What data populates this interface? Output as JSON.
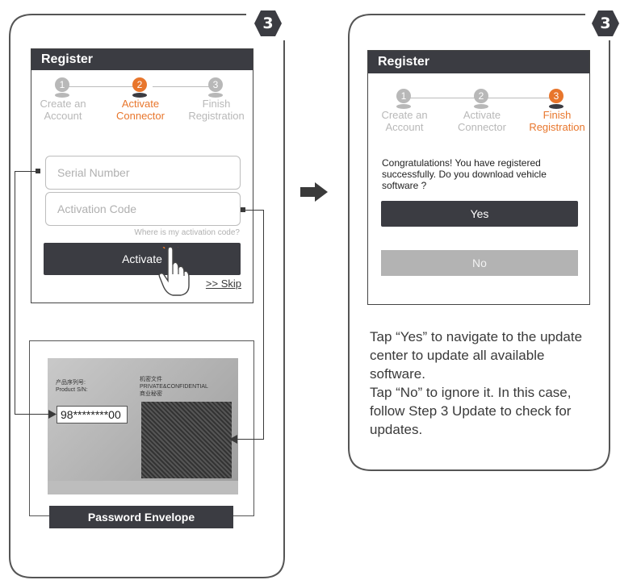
{
  "badges": {
    "left": "3",
    "right": "3"
  },
  "left_phone": {
    "title": "Register",
    "steps": [
      {
        "num": "1",
        "label": "Create an Account",
        "state": "done"
      },
      {
        "num": "2",
        "label": "Activate Connector",
        "state": "active"
      },
      {
        "num": "3",
        "label": "Finish Registration",
        "state": "todo"
      }
    ],
    "serial_placeholder": "Serial Number",
    "activation_placeholder": "Activation Code",
    "help_link": "Where is my activation code?",
    "activate_label": "Activate",
    "skip_label": ">> Skip"
  },
  "envelope": {
    "product_label_cn": "产品序列号:",
    "product_label_en": "Product S/N:",
    "conf_cn": "机密文件",
    "conf_en": "PRIVATE&CONFIDENTIAL",
    "conf_sub": "商业秘密",
    "serial_value": "98********00",
    "caption": "Password Envelope"
  },
  "right_phone": {
    "title": "Register",
    "steps": [
      {
        "num": "1",
        "label": "Create an Account",
        "state": "todo"
      },
      {
        "num": "2",
        "label": "Activate Connector",
        "state": "todo"
      },
      {
        "num": "3",
        "label": "Finish Registration",
        "state": "active"
      }
    ],
    "message": "Congratulations! You have registered successfully. Do you download vehicle software ?",
    "yes_label": "Yes",
    "no_label": "No"
  },
  "instructions": [
    "Tap “Yes” to navigate to the update center to update all available software.",
    "Tap “No” to ignore it. In this case, follow Step 3 Update to check for updates."
  ],
  "colors": {
    "accent": "#e8762c",
    "dark": "#3b3c42",
    "inactive": "#b8b8b8"
  },
  "icons": {
    "arrow": "right-arrow-icon",
    "hand": "pointing-hand-icon"
  }
}
